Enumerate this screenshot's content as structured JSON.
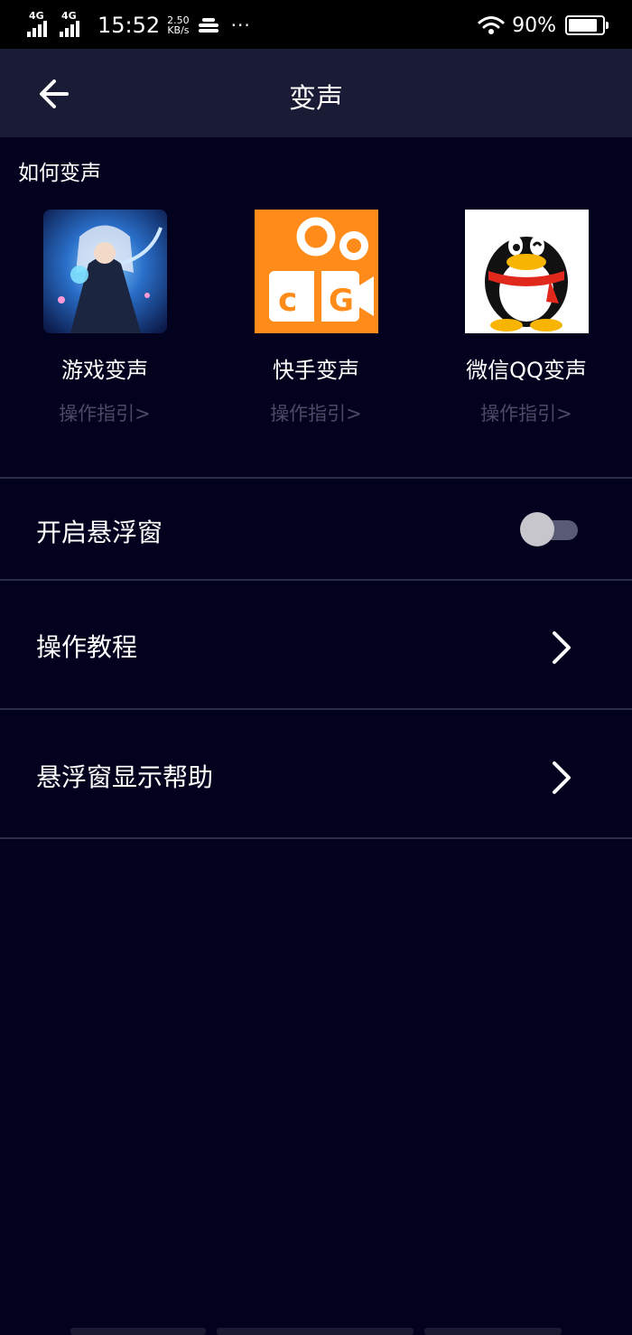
{
  "status_bar": {
    "net1": "4G",
    "net2": "4G",
    "time": "15:52",
    "speed_value": "2.50",
    "speed_unit": "KB/s",
    "more": "···",
    "battery_pct": "90%",
    "battery_level": 0.9
  },
  "header": {
    "title": "变声",
    "back_icon": "arrow-left-icon"
  },
  "section": {
    "title": "如何变声"
  },
  "cards": [
    {
      "name": "游戏变声",
      "guide": "操作指引>",
      "icon": "game-character-image"
    },
    {
      "name": "快手变声",
      "guide": "操作指引>",
      "icon": "kuaishou-logo"
    },
    {
      "name": "微信QQ变声",
      "guide": "操作指引>",
      "icon": "qq-penguin-logo"
    }
  ],
  "settings": {
    "float_window": {
      "label": "开启悬浮窗",
      "enabled": false
    },
    "tutorial": {
      "label": "操作教程"
    },
    "float_help": {
      "label": "悬浮窗显示帮助"
    }
  },
  "colors": {
    "background": "#03021e",
    "appbar": "#1a1c36",
    "kuaishou_orange": "#ff8c1a",
    "guide_text": "#4a4b63"
  }
}
